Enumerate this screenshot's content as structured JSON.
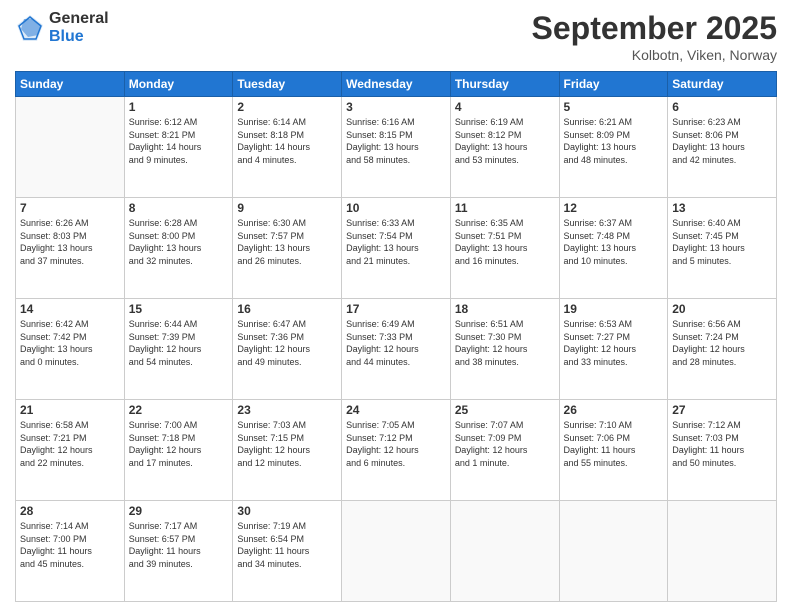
{
  "header": {
    "logo_general": "General",
    "logo_blue": "Blue",
    "month_title": "September 2025",
    "location": "Kolbotn, Viken, Norway"
  },
  "days_of_week": [
    "Sunday",
    "Monday",
    "Tuesday",
    "Wednesday",
    "Thursday",
    "Friday",
    "Saturday"
  ],
  "weeks": [
    [
      {
        "day": "",
        "info": ""
      },
      {
        "day": "1",
        "info": "Sunrise: 6:12 AM\nSunset: 8:21 PM\nDaylight: 14 hours\nand 9 minutes."
      },
      {
        "day": "2",
        "info": "Sunrise: 6:14 AM\nSunset: 8:18 PM\nDaylight: 14 hours\nand 4 minutes."
      },
      {
        "day": "3",
        "info": "Sunrise: 6:16 AM\nSunset: 8:15 PM\nDaylight: 13 hours\nand 58 minutes."
      },
      {
        "day": "4",
        "info": "Sunrise: 6:19 AM\nSunset: 8:12 PM\nDaylight: 13 hours\nand 53 minutes."
      },
      {
        "day": "5",
        "info": "Sunrise: 6:21 AM\nSunset: 8:09 PM\nDaylight: 13 hours\nand 48 minutes."
      },
      {
        "day": "6",
        "info": "Sunrise: 6:23 AM\nSunset: 8:06 PM\nDaylight: 13 hours\nand 42 minutes."
      }
    ],
    [
      {
        "day": "7",
        "info": "Sunrise: 6:26 AM\nSunset: 8:03 PM\nDaylight: 13 hours\nand 37 minutes."
      },
      {
        "day": "8",
        "info": "Sunrise: 6:28 AM\nSunset: 8:00 PM\nDaylight: 13 hours\nand 32 minutes."
      },
      {
        "day": "9",
        "info": "Sunrise: 6:30 AM\nSunset: 7:57 PM\nDaylight: 13 hours\nand 26 minutes."
      },
      {
        "day": "10",
        "info": "Sunrise: 6:33 AM\nSunset: 7:54 PM\nDaylight: 13 hours\nand 21 minutes."
      },
      {
        "day": "11",
        "info": "Sunrise: 6:35 AM\nSunset: 7:51 PM\nDaylight: 13 hours\nand 16 minutes."
      },
      {
        "day": "12",
        "info": "Sunrise: 6:37 AM\nSunset: 7:48 PM\nDaylight: 13 hours\nand 10 minutes."
      },
      {
        "day": "13",
        "info": "Sunrise: 6:40 AM\nSunset: 7:45 PM\nDaylight: 13 hours\nand 5 minutes."
      }
    ],
    [
      {
        "day": "14",
        "info": "Sunrise: 6:42 AM\nSunset: 7:42 PM\nDaylight: 13 hours\nand 0 minutes."
      },
      {
        "day": "15",
        "info": "Sunrise: 6:44 AM\nSunset: 7:39 PM\nDaylight: 12 hours\nand 54 minutes."
      },
      {
        "day": "16",
        "info": "Sunrise: 6:47 AM\nSunset: 7:36 PM\nDaylight: 12 hours\nand 49 minutes."
      },
      {
        "day": "17",
        "info": "Sunrise: 6:49 AM\nSunset: 7:33 PM\nDaylight: 12 hours\nand 44 minutes."
      },
      {
        "day": "18",
        "info": "Sunrise: 6:51 AM\nSunset: 7:30 PM\nDaylight: 12 hours\nand 38 minutes."
      },
      {
        "day": "19",
        "info": "Sunrise: 6:53 AM\nSunset: 7:27 PM\nDaylight: 12 hours\nand 33 minutes."
      },
      {
        "day": "20",
        "info": "Sunrise: 6:56 AM\nSunset: 7:24 PM\nDaylight: 12 hours\nand 28 minutes."
      }
    ],
    [
      {
        "day": "21",
        "info": "Sunrise: 6:58 AM\nSunset: 7:21 PM\nDaylight: 12 hours\nand 22 minutes."
      },
      {
        "day": "22",
        "info": "Sunrise: 7:00 AM\nSunset: 7:18 PM\nDaylight: 12 hours\nand 17 minutes."
      },
      {
        "day": "23",
        "info": "Sunrise: 7:03 AM\nSunset: 7:15 PM\nDaylight: 12 hours\nand 12 minutes."
      },
      {
        "day": "24",
        "info": "Sunrise: 7:05 AM\nSunset: 7:12 PM\nDaylight: 12 hours\nand 6 minutes."
      },
      {
        "day": "25",
        "info": "Sunrise: 7:07 AM\nSunset: 7:09 PM\nDaylight: 12 hours\nand 1 minute."
      },
      {
        "day": "26",
        "info": "Sunrise: 7:10 AM\nSunset: 7:06 PM\nDaylight: 11 hours\nand 55 minutes."
      },
      {
        "day": "27",
        "info": "Sunrise: 7:12 AM\nSunset: 7:03 PM\nDaylight: 11 hours\nand 50 minutes."
      }
    ],
    [
      {
        "day": "28",
        "info": "Sunrise: 7:14 AM\nSunset: 7:00 PM\nDaylight: 11 hours\nand 45 minutes."
      },
      {
        "day": "29",
        "info": "Sunrise: 7:17 AM\nSunset: 6:57 PM\nDaylight: 11 hours\nand 39 minutes."
      },
      {
        "day": "30",
        "info": "Sunrise: 7:19 AM\nSunset: 6:54 PM\nDaylight: 11 hours\nand 34 minutes."
      },
      {
        "day": "",
        "info": ""
      },
      {
        "day": "",
        "info": ""
      },
      {
        "day": "",
        "info": ""
      },
      {
        "day": "",
        "info": ""
      }
    ]
  ]
}
